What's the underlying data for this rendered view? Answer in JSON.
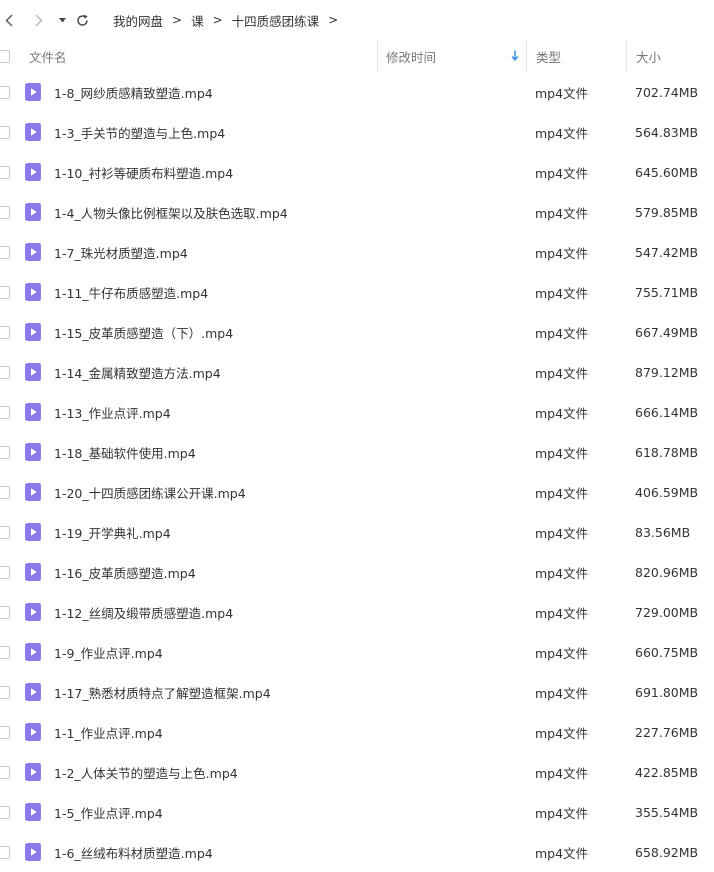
{
  "nav": {
    "back_icon": "chevron-left-icon",
    "forward_icon": "chevron-right-icon",
    "dropdown_icon": "caret-down-icon",
    "refresh_icon": "refresh-icon"
  },
  "breadcrumb": [
    "我的网盘",
    "课",
    "十四质感团练课"
  ],
  "breadcrumb_separator": ">",
  "columns": {
    "name": "文件名",
    "modified": "修改时间",
    "type": "类型",
    "size": "大小"
  },
  "colors": {
    "video_icon": "#8b7bea",
    "sort_arrow": "#2b8cf0"
  },
  "files": [
    {
      "name": "1-8_网纱质感精致塑造.mp4",
      "type": "mp4文件",
      "size": "702.74MB"
    },
    {
      "name": "1-3_手关节的塑造与上色.mp4",
      "type": "mp4文件",
      "size": "564.83MB"
    },
    {
      "name": "1-10_衬衫等硬质布料塑造.mp4",
      "type": "mp4文件",
      "size": "645.60MB"
    },
    {
      "name": "1-4_人物头像比例框架以及肤色选取.mp4",
      "type": "mp4文件",
      "size": "579.85MB"
    },
    {
      "name": "1-7_珠光材质塑造.mp4",
      "type": "mp4文件",
      "size": "547.42MB"
    },
    {
      "name": "1-11_牛仔布质感塑造.mp4",
      "type": "mp4文件",
      "size": "755.71MB"
    },
    {
      "name": "1-15_皮革质感塑造（下）.mp4",
      "type": "mp4文件",
      "size": "667.49MB"
    },
    {
      "name": "1-14_金属精致塑造方法.mp4",
      "type": "mp4文件",
      "size": "879.12MB"
    },
    {
      "name": "1-13_作业点评.mp4",
      "type": "mp4文件",
      "size": "666.14MB"
    },
    {
      "name": "1-18_基础软件使用.mp4",
      "type": "mp4文件",
      "size": "618.78MB"
    },
    {
      "name": "1-20_十四质感团练课公开课.mp4",
      "type": "mp4文件",
      "size": "406.59MB"
    },
    {
      "name": "1-19_开学典礼.mp4",
      "type": "mp4文件",
      "size": "83.56MB"
    },
    {
      "name": "1-16_皮革质感塑造.mp4",
      "type": "mp4文件",
      "size": "820.96MB"
    },
    {
      "name": "1-12_丝绸及缎带质感塑造.mp4",
      "type": "mp4文件",
      "size": "729.00MB"
    },
    {
      "name": "1-9_作业点评.mp4",
      "type": "mp4文件",
      "size": "660.75MB"
    },
    {
      "name": "1-17_熟悉材质特点了解塑造框架.mp4",
      "type": "mp4文件",
      "size": "691.80MB"
    },
    {
      "name": "1-1_作业点评.mp4",
      "type": "mp4文件",
      "size": "227.76MB"
    },
    {
      "name": "1-2_人体关节的塑造与上色.mp4",
      "type": "mp4文件",
      "size": "422.85MB"
    },
    {
      "name": "1-5_作业点评.mp4",
      "type": "mp4文件",
      "size": "355.54MB"
    },
    {
      "name": "1-6_丝绒布料材质塑造.mp4",
      "type": "mp4文件",
      "size": "658.92MB"
    }
  ]
}
